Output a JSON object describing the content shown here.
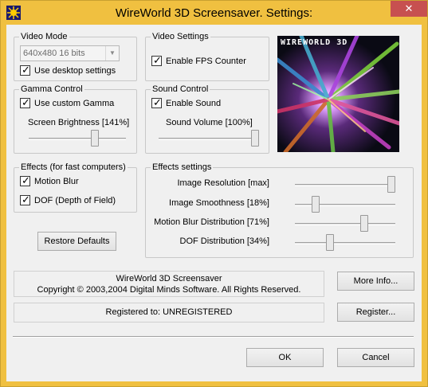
{
  "window": {
    "title": "WireWorld 3D Screensaver. Settings:",
    "close_symbol": "✕"
  },
  "video_mode": {
    "label": "Video Mode",
    "resolution_value": "640x480 16 bits",
    "use_desktop_label": "Use desktop settings",
    "use_desktop_checked": true
  },
  "video_settings": {
    "label": "Video Settings",
    "fps_label": "Enable FPS Counter",
    "fps_checked": true
  },
  "preview": {
    "caption": "WIREWORLD 3D"
  },
  "gamma": {
    "label": "Gamma Control",
    "custom_label": "Use custom Gamma",
    "custom_checked": true,
    "brightness_label": "Screen Brightness [141%]",
    "brightness_level": 0.7
  },
  "sound": {
    "label": "Sound Control",
    "enable_label": "Enable Sound",
    "enable_checked": true,
    "volume_label": "Sound Volume [100%]",
    "volume_level": 1.0
  },
  "effects": {
    "label": "Effects (for fast computers)",
    "motion_blur_label": "Motion Blur",
    "motion_blur_checked": true,
    "dof_label": "DOF (Depth of Field)",
    "dof_checked": true
  },
  "effects_settings": {
    "label": "Effects settings",
    "sliders": [
      {
        "label": "Image Resolution [max]",
        "level": 1.0
      },
      {
        "label": "Image Smoothness [18%]",
        "level": 0.18
      },
      {
        "label": "Motion Blur Distribution [71%]",
        "level": 0.71
      },
      {
        "label": "DOF Distribution [34%]",
        "level": 0.34
      }
    ]
  },
  "buttons": {
    "restore_defaults": "Restore Defaults",
    "more_info": "More Info...",
    "register": "Register...",
    "ok": "OK",
    "cancel": "Cancel"
  },
  "info": {
    "product": "WireWorld 3D Screensaver",
    "copyright": "Copyright © 2003,2004 Digital Minds Software. All Rights Reserved.",
    "registered": "Registered to: UNREGISTERED"
  }
}
